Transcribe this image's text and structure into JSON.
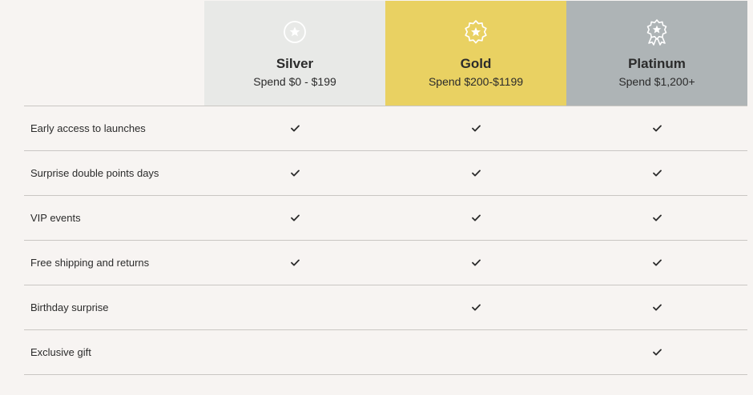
{
  "tiers": [
    {
      "name": "Silver",
      "spend": "Spend $0 - $199",
      "icon": "star-circle-icon",
      "color": "#e8e9e7"
    },
    {
      "name": "Gold",
      "spend": "Spend $200-$1199",
      "icon": "star-badge-icon",
      "color": "#e9d162"
    },
    {
      "name": "Platinum",
      "spend": "Spend $1,200+",
      "icon": "star-rosette-icon",
      "color": "#aeb4b6"
    }
  ],
  "benefits": [
    {
      "label": "Early access to launches",
      "silver": true,
      "gold": true,
      "platinum": true
    },
    {
      "label": "Surprise double points days",
      "silver": true,
      "gold": true,
      "platinum": true
    },
    {
      "label": "VIP events",
      "silver": true,
      "gold": true,
      "platinum": true
    },
    {
      "label": "Free shipping and returns",
      "silver": true,
      "gold": true,
      "platinum": true
    },
    {
      "label": "Birthday surprise",
      "silver": false,
      "gold": true,
      "platinum": true
    },
    {
      "label": "Exclusive gift",
      "silver": false,
      "gold": false,
      "platinum": true
    }
  ],
  "colors": {
    "background": "#f7f4f2",
    "divider": "#c9c6c3",
    "text": "#2b2b2b",
    "check": "#2b2b2b"
  }
}
